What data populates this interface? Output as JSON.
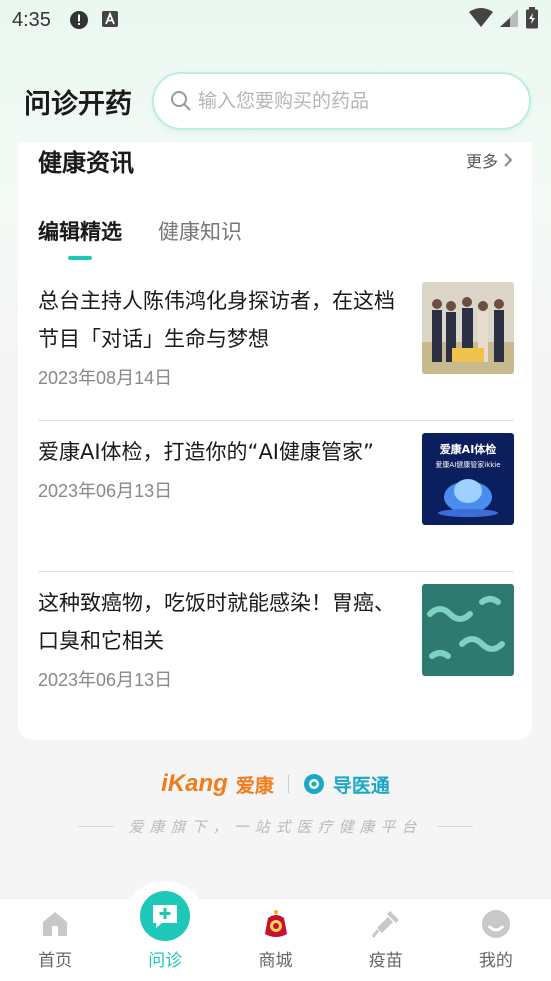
{
  "status_bar": {
    "time": "4:35",
    "icons": [
      "alert-icon",
      "a-icon",
      "wifi-icon",
      "signal-icon",
      "battery-icon"
    ]
  },
  "header": {
    "title": "问诊开药",
    "search_placeholder": "输入您要购买的药品"
  },
  "news": {
    "section_title": "健康资讯",
    "more_label": "更多",
    "tabs": [
      {
        "label": "编辑精选",
        "active": true
      },
      {
        "label": "健康知识",
        "active": false
      }
    ],
    "articles": [
      {
        "title": "总台主持人陈伟鸿化身探访者，在这档节目「对话」生命与梦想",
        "date": "2023年08月14日",
        "thumb": "people-on-stage-image"
      },
      {
        "title": "爱康AI体检，打造你的“AI健康管家”",
        "date": "2023年06月13日",
        "thumb": "ai-cloud-image",
        "thumb_text_1": "爱康AI体检",
        "thumb_text_2": "爱康AI健康管家ikkie"
      },
      {
        "title": "这种致癌物，吃饭时就能感染！胃癌、口臭和它相关",
        "date": "2023年06月13日",
        "thumb": "bacteria-image"
      }
    ]
  },
  "brand": {
    "ikang": "iKang",
    "ikang_cn": "爱康",
    "daoyitong": "导医通",
    "slogan": "爱康旗下，一站式医疗健康平台"
  },
  "bottom_nav": [
    {
      "label": "首页",
      "icon": "home-icon",
      "active": false
    },
    {
      "label": "问诊",
      "icon": "consult-icon",
      "active": true
    },
    {
      "label": "商城",
      "icon": "mall-icon",
      "active": false
    },
    {
      "label": "疫苗",
      "icon": "vaccine-icon",
      "active": false
    },
    {
      "label": "我的",
      "icon": "profile-icon",
      "active": false
    }
  ],
  "colors": {
    "accent": "#1ec8b8",
    "brand_orange": "#f07c1b",
    "brand_blue": "#1aa7c8"
  }
}
